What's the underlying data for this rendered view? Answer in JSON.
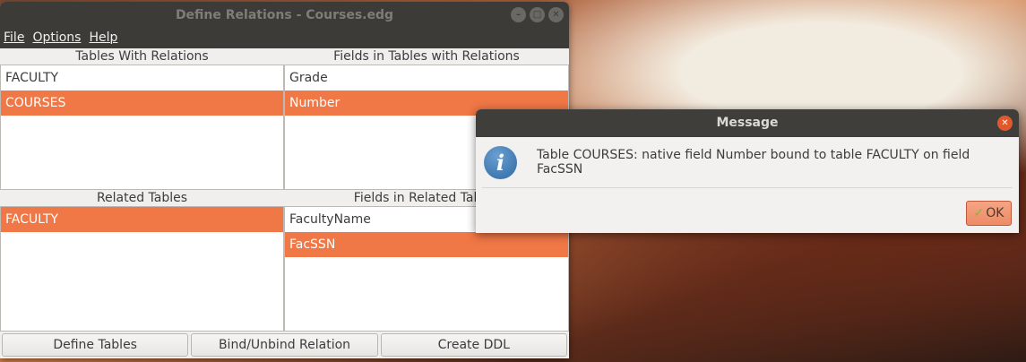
{
  "main_window": {
    "title": "Define Relations - Courses.edg",
    "menu": [
      "File",
      "Options",
      "Help"
    ],
    "tables_with_relations": {
      "header": "Tables With Relations",
      "items": [
        "FACULTY",
        "COURSES"
      ],
      "selected": 1
    },
    "fields_in_tables": {
      "header": "Fields in Tables with Relations",
      "items": [
        "Grade",
        "Number"
      ],
      "selected": 1
    },
    "related_tables": {
      "header": "Related Tables",
      "items": [
        "FACULTY"
      ],
      "selected": 0
    },
    "fields_in_related": {
      "header": "Fields in Related Tables",
      "items": [
        "FacultyName",
        "FacSSN"
      ],
      "selected": 1
    },
    "buttons": {
      "define": "Define Tables",
      "bind": "Bind/Unbind Relation",
      "ddl": "Create DDL"
    }
  },
  "dialog": {
    "title": "Message",
    "message": "Table COURSES: native field Number bound to table FACULTY on field FacSSN",
    "ok": "OK"
  },
  "colors": {
    "selection": "#f07746",
    "titlebar": "#3d3b37"
  }
}
